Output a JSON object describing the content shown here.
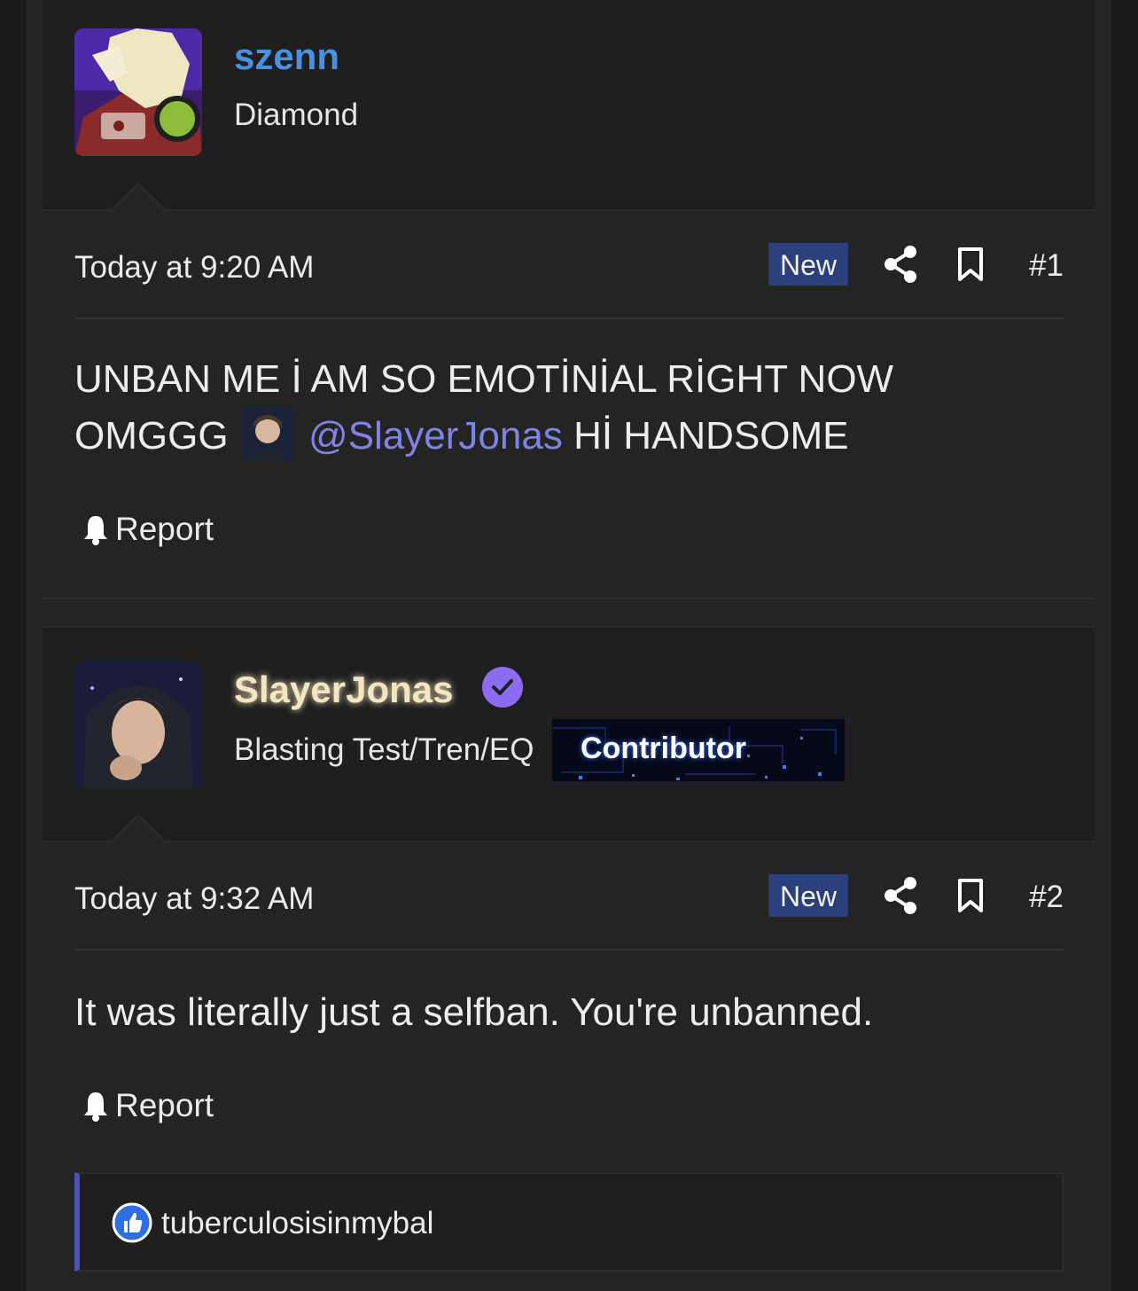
{
  "posts": [
    {
      "username": "szenn",
      "username_color": "#4a90e2",
      "user_title": "Diamond",
      "online": true,
      "date": "Today at 9:20 AM",
      "badge": "New",
      "post_number": "#1",
      "body_line1": "UNBAN ME İ AM SO EMOTİNİAL RİGHT NOW",
      "body_line2_before": "OMGGG",
      "mention": "@SlayerJonas",
      "body_line2_after": "Hİ HANDSOME",
      "report_label": "Report"
    },
    {
      "username": "SlayerJonas",
      "username_color": "#f3e6c0",
      "user_title": "Blasting Test/Tren/EQ",
      "verified": true,
      "banner": "Contributor",
      "date": "Today at 9:32 AM",
      "badge": "New",
      "post_number": "#2",
      "body": "It was literally just a selfban. You're unbanned.",
      "report_label": "Report"
    }
  ],
  "reactions": {
    "icon": "like-icon",
    "users": "tuberculosisinmybal"
  },
  "colors": {
    "badge_new": "#2a3f7c",
    "mention": "#7e83e6",
    "online": "#8dbb3a",
    "verified": "#8b6cf2",
    "reaction_accent": "#4a52b8"
  }
}
